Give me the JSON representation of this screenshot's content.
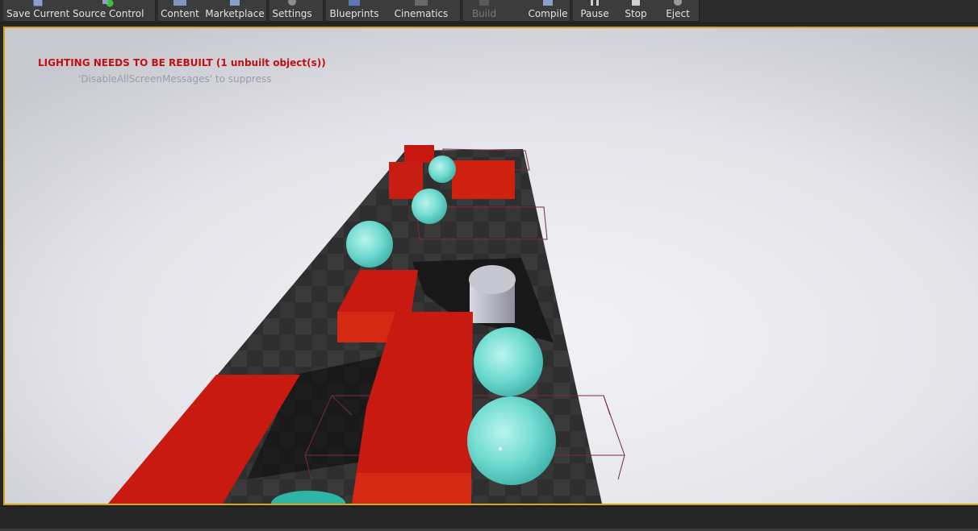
{
  "toolbar": {
    "buttons": [
      {
        "label": "Save Current",
        "icon": "save-icon"
      },
      {
        "label": "Source Control",
        "icon": "source-control-icon"
      },
      {
        "label": "Content",
        "icon": "content-icon"
      },
      {
        "label": "Marketplace",
        "icon": "marketplace-icon"
      },
      {
        "label": "Settings",
        "icon": "settings-icon"
      },
      {
        "label": "Blueprints",
        "icon": "blueprints-icon"
      },
      {
        "label": "Cinematics",
        "icon": "cinematics-icon"
      },
      {
        "label": "Build",
        "icon": "build-icon",
        "disabled": true
      },
      {
        "label": "Compile",
        "icon": "compile-icon"
      },
      {
        "label": "Pause",
        "icon": "pause-icon"
      },
      {
        "label": "Stop",
        "icon": "stop-icon"
      },
      {
        "label": "Eject",
        "icon": "eject-icon"
      }
    ]
  },
  "viewport": {
    "warning": "LIGHTING NEEDS TO BE REBUILT (1 unbuilt object(s))",
    "hint": "'DisableAllScreenMessages' to suppress"
  },
  "colors": {
    "viewport_border": "#d4a51a",
    "warning_text": "#c01010",
    "cube_red": "#c8170f",
    "sphere_cyan": "#6fdcd2",
    "floor": "#2f2f2f",
    "sky": "#e6e6ec"
  }
}
